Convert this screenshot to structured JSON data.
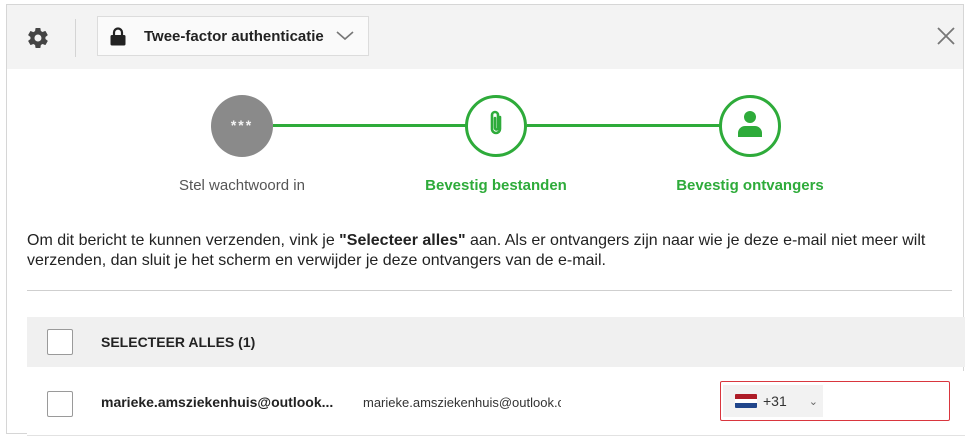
{
  "header": {
    "dropdown_label": "Twee-factor authenticatie",
    "icons": [
      "gear-icon",
      "lock-icon",
      "chevron-down-icon",
      "close-icon"
    ]
  },
  "steps": [
    {
      "label": "Stel wachtwoord in",
      "state": "done",
      "icon": "dots-icon",
      "symbol": "***"
    },
    {
      "label": "Bevestig bestanden",
      "state": "active",
      "icon": "paperclip-icon"
    },
    {
      "label": "Bevestig ontvangers",
      "state": "active",
      "icon": "person-icon"
    }
  ],
  "instruction": {
    "part1": "Om dit bericht te kunnen verzenden, vink je ",
    "quote_open": "\"",
    "bold": "Selecteer alles",
    "quote_close": "\"",
    "part2": " aan. Als er ontvangers zijn naar wie je deze e-mail niet meer wilt verzenden, dan sluit je het scherm en verwijder je deze ontvangers van de e-mail."
  },
  "select_all": {
    "label": "SELECTEER ALLES (1)",
    "checked": false
  },
  "recipients": [
    {
      "name": "marieke.amsziekenhuis@outlook...",
      "email": "marieke.amsziekenhuis@outlook.com",
      "checked": false,
      "country_code": "+31",
      "phone_value": ""
    }
  ],
  "colors": {
    "accent_green": "#2eab3a",
    "done_gray": "#8a8a8a",
    "error_red": "#d9363e",
    "flag_red": "#ae1c28",
    "flag_white": "#ffffff",
    "flag_blue": "#21468b"
  }
}
